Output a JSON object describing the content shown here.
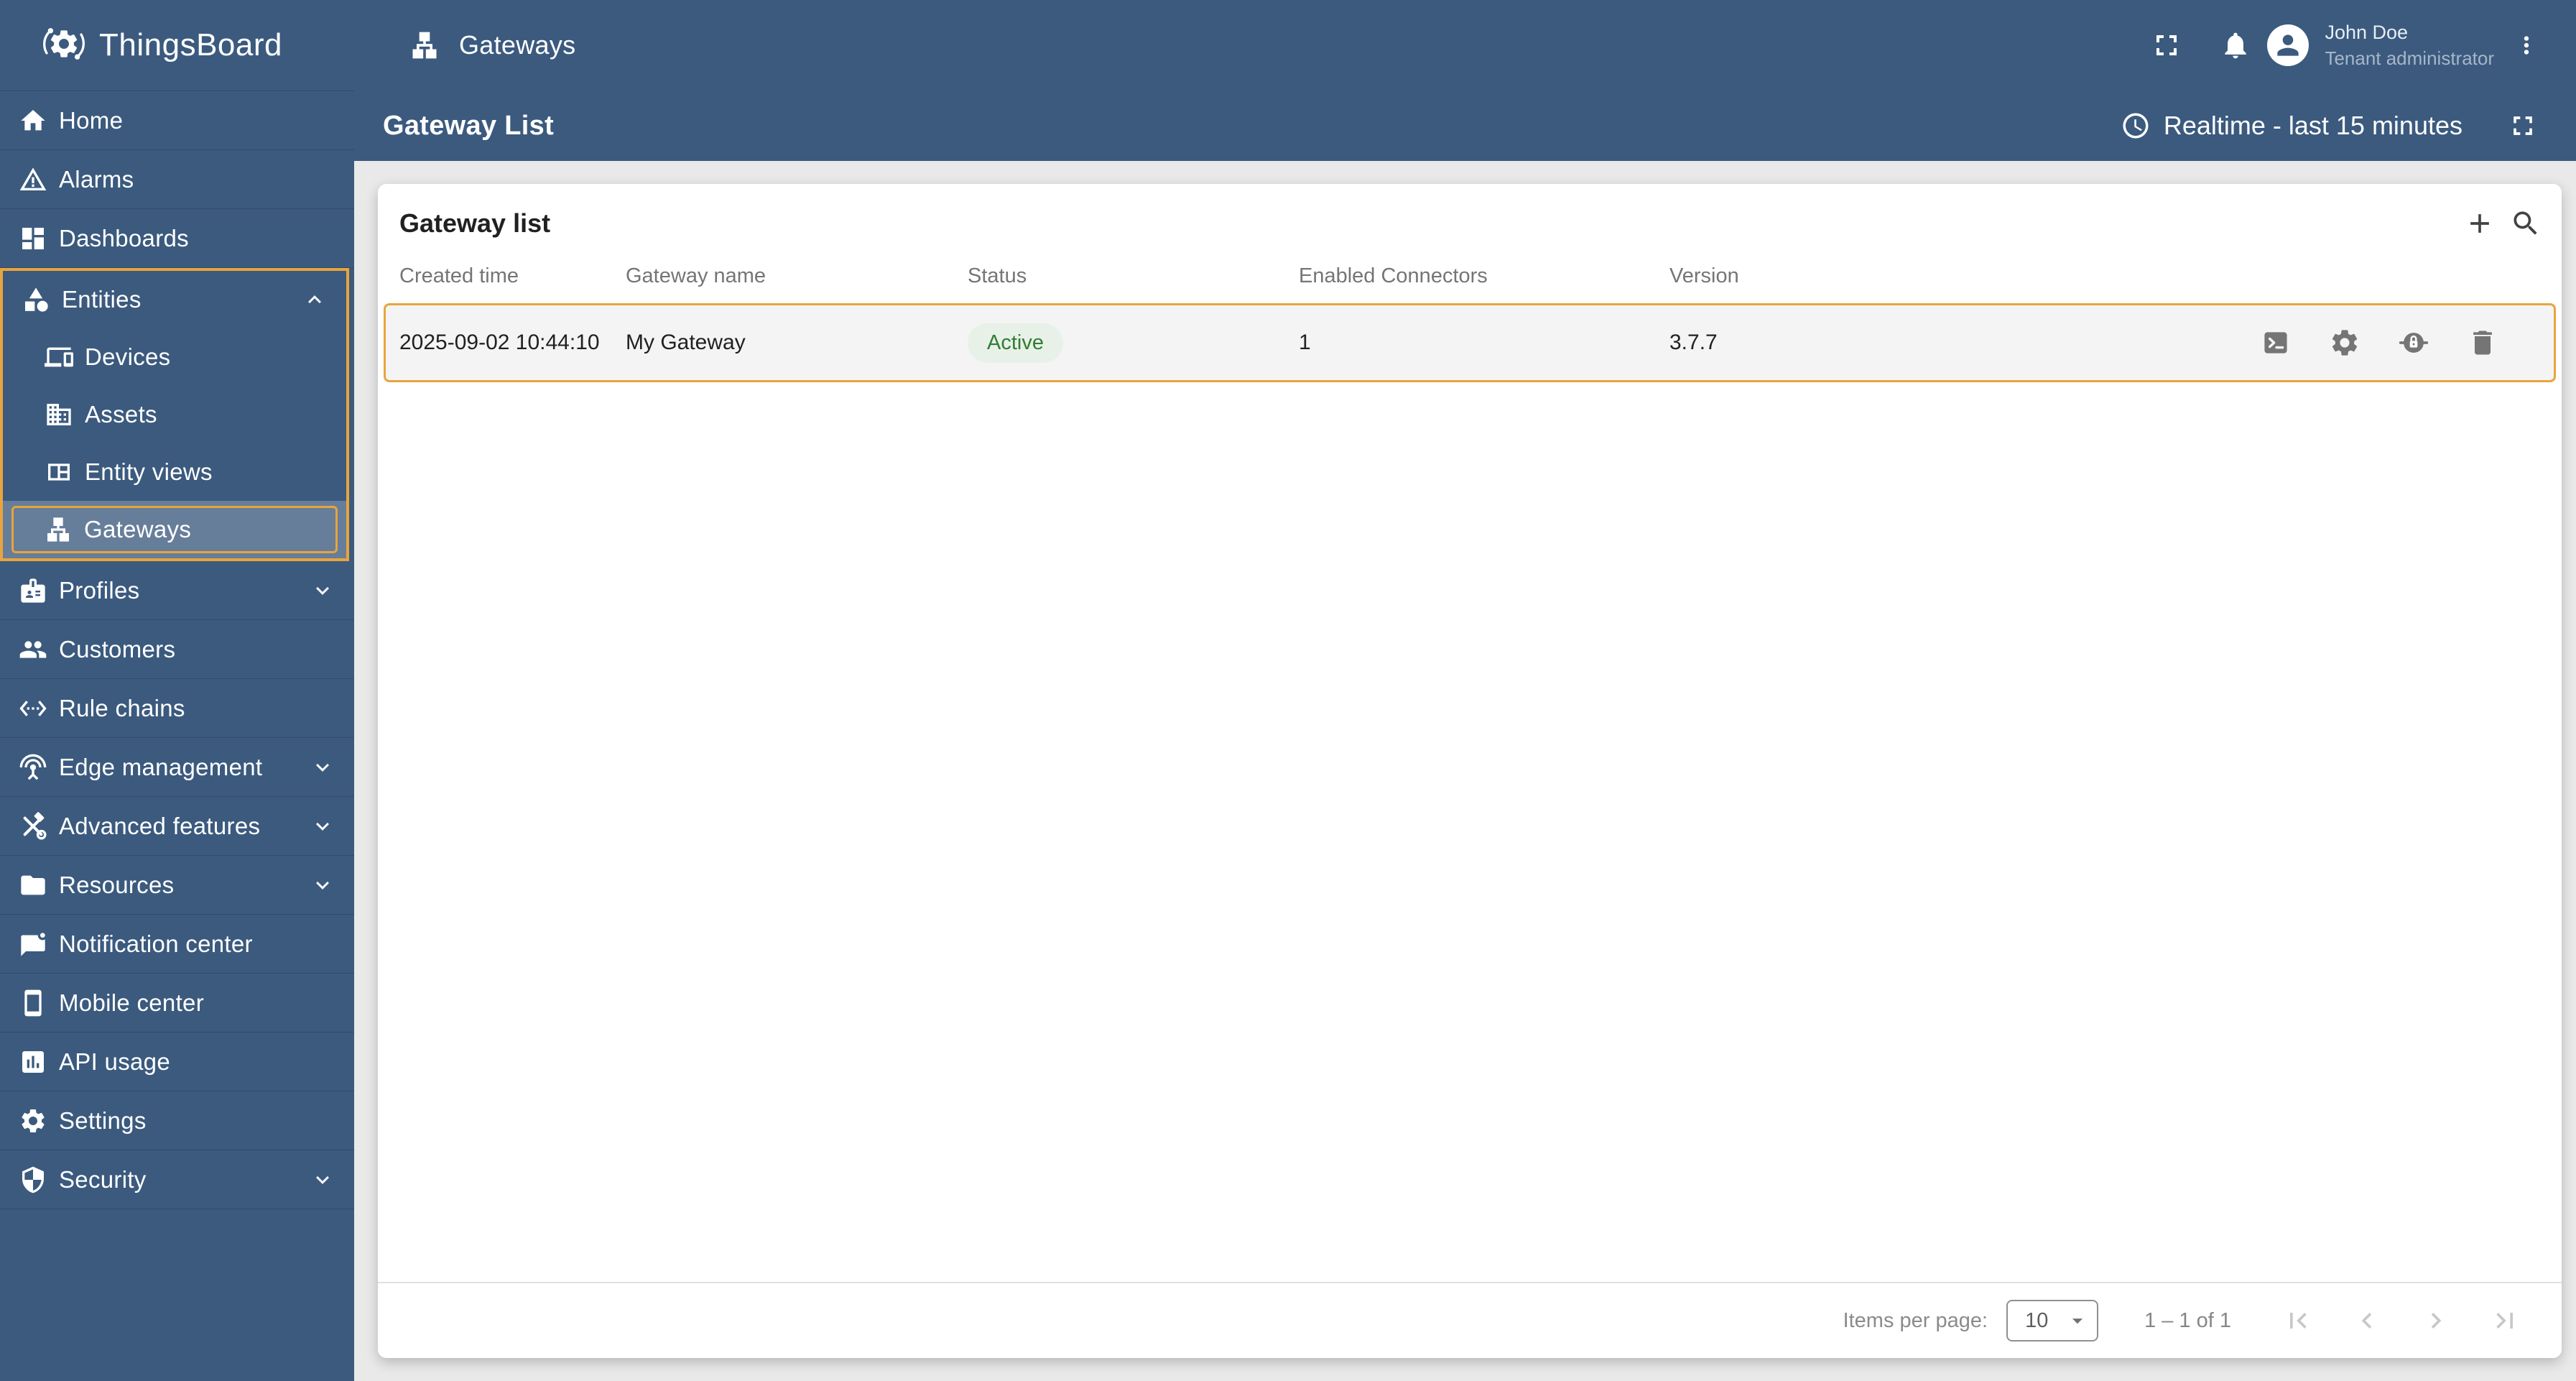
{
  "brand": {
    "name": "ThingsBoard"
  },
  "header": {
    "title": "Gateways",
    "user_name": "John Doe",
    "user_role": "Tenant administrator"
  },
  "toolbar": {
    "title": "Gateway List",
    "timewindow": "Realtime - last 15 minutes"
  },
  "sidebar": {
    "items": [
      {
        "label": "Home"
      },
      {
        "label": "Alarms"
      },
      {
        "label": "Dashboards"
      },
      {
        "label": "Entities"
      },
      {
        "label": "Devices"
      },
      {
        "label": "Assets"
      },
      {
        "label": "Entity views"
      },
      {
        "label": "Gateways"
      },
      {
        "label": "Profiles"
      },
      {
        "label": "Customers"
      },
      {
        "label": "Rule chains"
      },
      {
        "label": "Edge management"
      },
      {
        "label": "Advanced features"
      },
      {
        "label": "Resources"
      },
      {
        "label": "Notification center"
      },
      {
        "label": "Mobile center"
      },
      {
        "label": "API usage"
      },
      {
        "label": "Settings"
      },
      {
        "label": "Security"
      }
    ]
  },
  "card": {
    "title": "Gateway list",
    "columns": [
      "Created time",
      "Gateway name",
      "Status",
      "Enabled Connectors",
      "Version"
    ],
    "rows": [
      {
        "created_time": "2025-09-02 10:44:10",
        "name": "My Gateway",
        "status": "Active",
        "enabled_connectors": "1",
        "version": "3.7.7"
      }
    ]
  },
  "pagination": {
    "items_per_page_label": "Items per page:",
    "page_size": "10",
    "range": "1 – 1 of 1"
  },
  "colors": {
    "primary_blue": "#3b5a7e",
    "highlight_orange": "#e9a43d",
    "status_active_text": "#2f7d33",
    "status_active_bg": "#e8f1e8"
  }
}
